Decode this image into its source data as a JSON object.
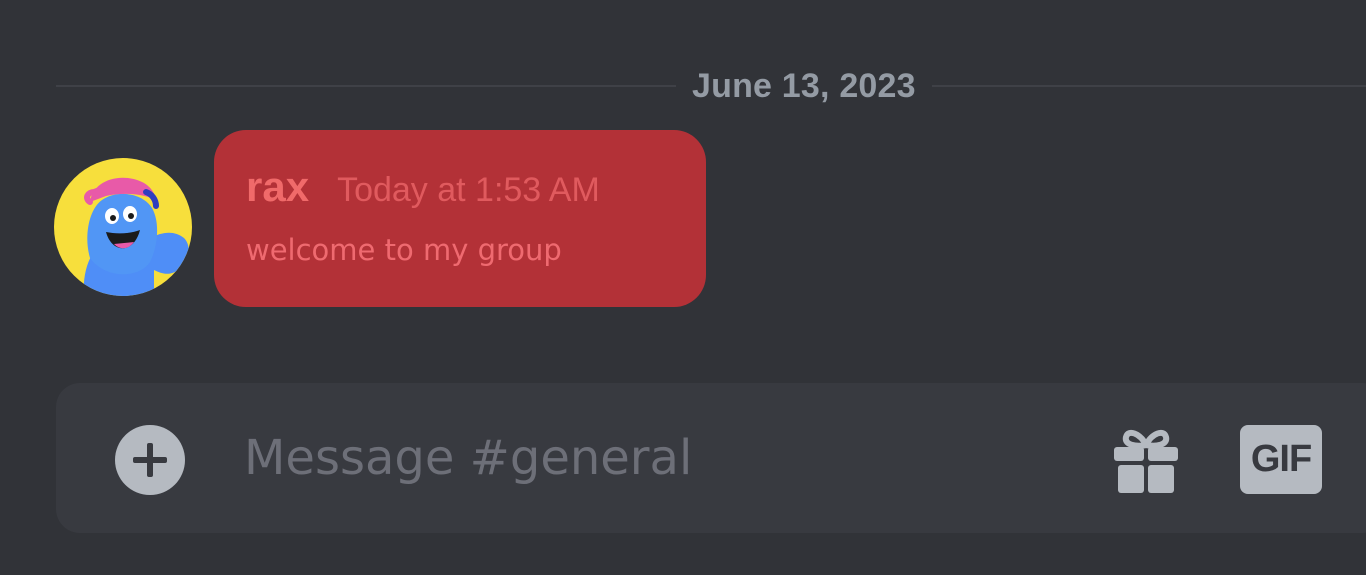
{
  "divider": {
    "date": "June 13, 2023"
  },
  "message": {
    "username": "rax",
    "timestamp": "Today at 1:53 AM",
    "body": "welcome to my group",
    "bubble_color": "#b33137"
  },
  "composer": {
    "placeholder": "Message #general",
    "gif_label": "GIF",
    "icons": {
      "add": "plus-circle-icon",
      "gift": "gift-icon"
    }
  }
}
